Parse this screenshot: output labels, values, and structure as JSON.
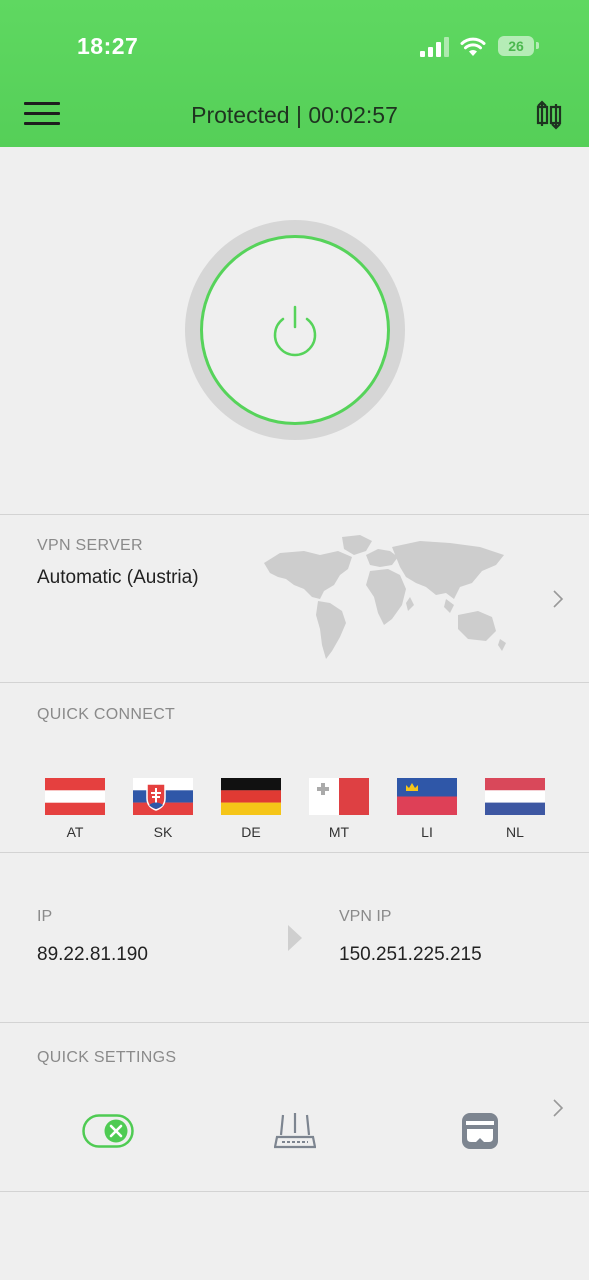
{
  "status_bar": {
    "time": "18:27",
    "battery": "26",
    "icons": [
      "signal-icon",
      "wifi-icon",
      "battery-icon"
    ]
  },
  "header": {
    "title": "Protected | 00:02:57",
    "icons": [
      "menu-icon",
      "server-switch-icon"
    ]
  },
  "power": {
    "icon": "power-icon",
    "colors": {
      "accent": "#56d35a",
      "ring": "#d6d6d6"
    }
  },
  "server": {
    "label": "VPN SERVER",
    "value": "Automatic (Austria)"
  },
  "quick_connect": {
    "label": "QUICK CONNECT",
    "flags": [
      {
        "code": "AT"
      },
      {
        "code": "SK"
      },
      {
        "code": "DE"
      },
      {
        "code": "MT"
      },
      {
        "code": "LI"
      },
      {
        "code": "NL"
      }
    ]
  },
  "ip": {
    "label": "IP",
    "value": "89.22.81.190",
    "vpn_label": "VPN IP",
    "vpn_value": "150.251.225.215"
  },
  "quick_settings": {
    "label": "QUICK SETTINGS",
    "items": [
      "kill-switch-toggle-icon",
      "router-icon",
      "incognito-mask-icon"
    ]
  }
}
